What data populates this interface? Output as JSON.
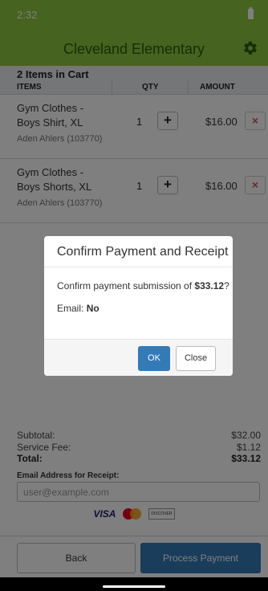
{
  "status_bar": {
    "time": "2:32"
  },
  "app_bar": {
    "title": "Cleveland Elementary",
    "settings_icon": "gear-icon"
  },
  "cart": {
    "count_label": "2 Items in Cart",
    "columns": {
      "items": "ITEMS",
      "qty": "QTY",
      "amount": "AMOUNT"
    },
    "items": [
      {
        "name": "Gym Clothes - Boys Shirt, XL",
        "student": "Aden Ahlers (103770)",
        "qty": "1",
        "amount": "$16.00",
        "add_label": "+",
        "remove_label": "×"
      },
      {
        "name": "Gym Clothes - Boys Shorts, XL",
        "student": "Aden Ahlers (103770)",
        "qty": "1",
        "amount": "$16.00",
        "add_label": "+",
        "remove_label": "×"
      }
    ]
  },
  "summary": {
    "subtotal_label": "Subtotal:",
    "subtotal_value": "$32.00",
    "fee_label": "Service Fee:",
    "fee_value": "$1.12",
    "total_label": "Total:",
    "total_value": "$33.12",
    "email_label": "Email Address for Receipt:",
    "email_placeholder": "user@example.com",
    "email_value": ""
  },
  "payment_cards": {
    "visa": "VISA",
    "mastercard": "mastercard-icon",
    "discover": "DISCOVER"
  },
  "footer": {
    "back_label": "Back",
    "pay_label": "Process Payment"
  },
  "modal": {
    "title": "Confirm Payment and Receipt",
    "confirm_prefix": "Confirm payment submission of ",
    "confirm_amount": "$33.12",
    "confirm_suffix": "?",
    "email_label": "Email: ",
    "email_value": "No",
    "ok_label": "OK",
    "close_label": "Close"
  },
  "colors": {
    "brand_green": "#8cc63f",
    "title_green": "#2e5d0e",
    "primary_blue": "#337ab7",
    "danger_red": "#d9534f"
  }
}
